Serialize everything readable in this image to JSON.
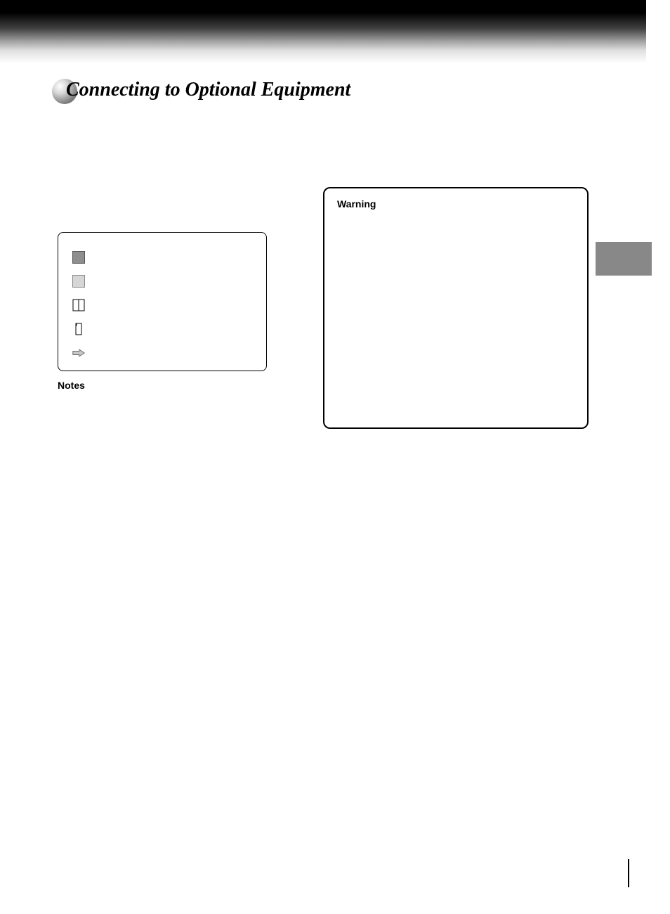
{
  "header": {
    "title": "Connecting to Optional Equipment"
  },
  "legend": {
    "items": [
      {
        "icon": "swatch-dark",
        "label": ""
      },
      {
        "icon": "swatch-light",
        "label": ""
      },
      {
        "icon": "book-icon",
        "label": ""
      },
      {
        "icon": "page-icon",
        "label": ""
      },
      {
        "icon": "arrow-right-icon",
        "label": ""
      }
    ],
    "notes_label": "Notes"
  },
  "warning_box": {
    "label": "Warning",
    "body": ""
  }
}
